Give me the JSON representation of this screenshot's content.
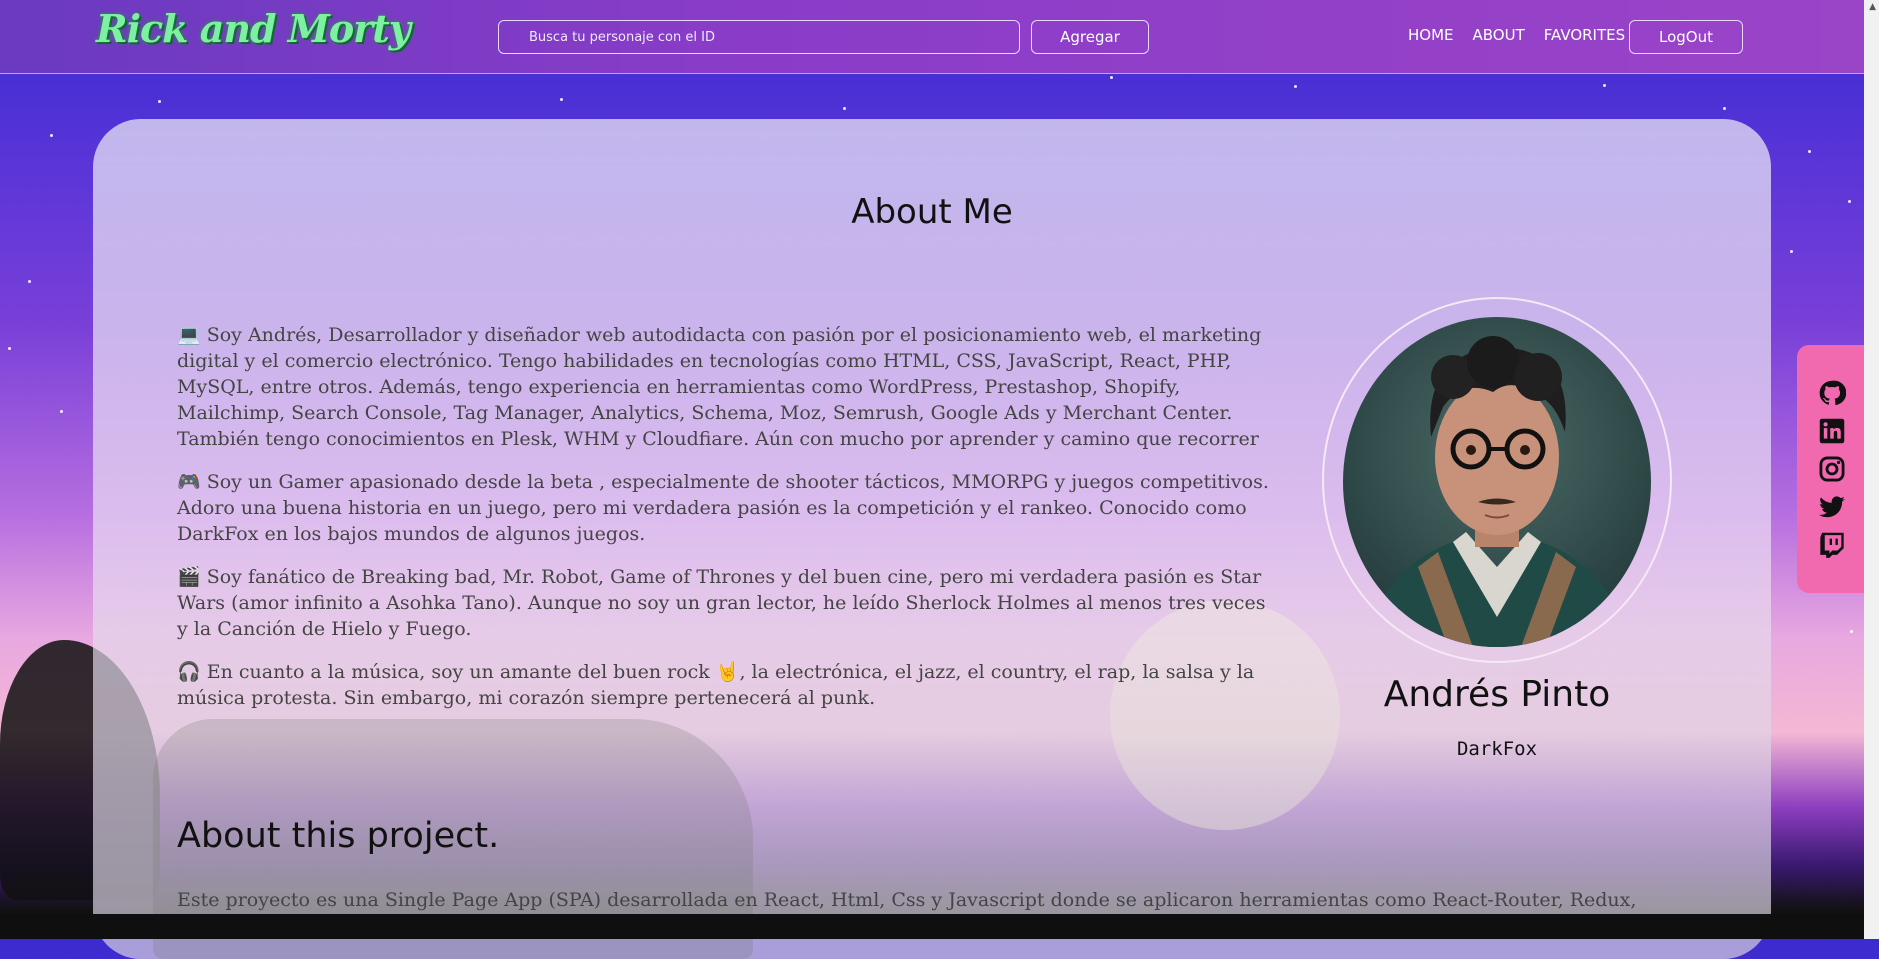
{
  "header": {
    "logo_text": "Rick and Morty",
    "search_placeholder": "Busca tu personaje con el ID",
    "add_label": "Agregar",
    "nav": [
      "HOME",
      "ABOUT",
      "FAVORITES"
    ],
    "logout_label": "LogOut"
  },
  "about": {
    "title": "About Me",
    "paragraphs": [
      {
        "emoji": "💻",
        "text": "Soy Andrés, Desarrollador y diseñador web autodidacta con pasión por el posicionamiento web, el marketing digital y el comercio electrónico. Tengo habilidades en tecnologías como HTML, CSS, JavaScript, React, PHP, MySQL, entre otros. Además, tengo experiencia en herramientas como WordPress, Prestashop, Shopify, Mailchimp, Search Console, Tag Manager, Analytics, Schema, Moz, Semrush, Google Ads y Merchant Center. También tengo conocimientos en Plesk, WHM y Cloudfiare. Aún con mucho por aprender y camino que recorrer"
      },
      {
        "emoji": "🎮",
        "text": "Soy un Gamer apasionado desde la beta , especialmente de shooter tácticos, MMORPG y juegos competitivos. Adoro una buena historia en un juego, pero mi verdadera pasión es la competición y el rankeo. Conocido como DarkFox en los bajos mundos de algunos juegos."
      },
      {
        "emoji": "🎬",
        "text": "Soy fanático de Breaking bad, Mr. Robot, Game of Thrones y del buen cine, pero mi verdadera pasión es Star Wars (amor infinito a Asohka Tano). Aunque no soy un gran lector, he leído Sherlock Holmes al menos tres veces y la Canción de Hielo y Fuego."
      },
      {
        "emoji": "🎧",
        "text": "En cuanto a la música, soy un amante del buen rock 🤘, la electrónica, el jazz, el country, el rap, la salsa y la música protesta. Sin embargo, mi corazón siempre pertenecerá al punk."
      }
    ]
  },
  "profile": {
    "name": "Andrés Pinto",
    "nickname": "DarkFox"
  },
  "project": {
    "title": "About this project.",
    "text": "Este proyecto es una Single Page App (SPA) desarrollada en React, Html, Css y Javascript donde se aplicaron herramientas como React-Router, Redux, Hooks, Styled Modules, entre otras."
  },
  "social": {
    "icons": [
      "github-icon",
      "linkedin-icon",
      "instagram-icon",
      "twitter-icon",
      "twitch-icon"
    ],
    "background": "#f16ab0"
  },
  "colors": {
    "navbar": "#8a3cc8",
    "logo": "#7ef0a2",
    "accent": "#f16ab0"
  }
}
